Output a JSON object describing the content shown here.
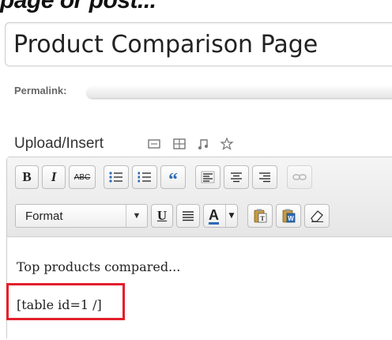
{
  "heading": "page or post...",
  "title": {
    "value": "Product Comparison Page"
  },
  "permalink": {
    "label": "Permalink:"
  },
  "upload": {
    "label": "Upload/Insert",
    "icons": [
      "image-icon",
      "video-icon",
      "audio-icon",
      "media-icon"
    ]
  },
  "toolbar": {
    "row1": [
      "bold-icon",
      "italic-icon",
      "strikethrough-icon",
      "bullet-list-icon",
      "numbered-list-icon",
      "blockquote-icon",
      "align-left-icon",
      "align-center-icon",
      "align-right-icon",
      "link-icon"
    ],
    "bold": "B",
    "italic": "I",
    "strike": "ABC",
    "quote": "“",
    "format_label": "Format",
    "underline": "U",
    "text_color": "A"
  },
  "editor": {
    "content": [
      "Top products compared...",
      "[table id=1 /]"
    ]
  },
  "colors": {
    "highlight": "#e41e2b",
    "toolbar_bg": "#ececec",
    "icon_blue": "#2b6bb7"
  }
}
